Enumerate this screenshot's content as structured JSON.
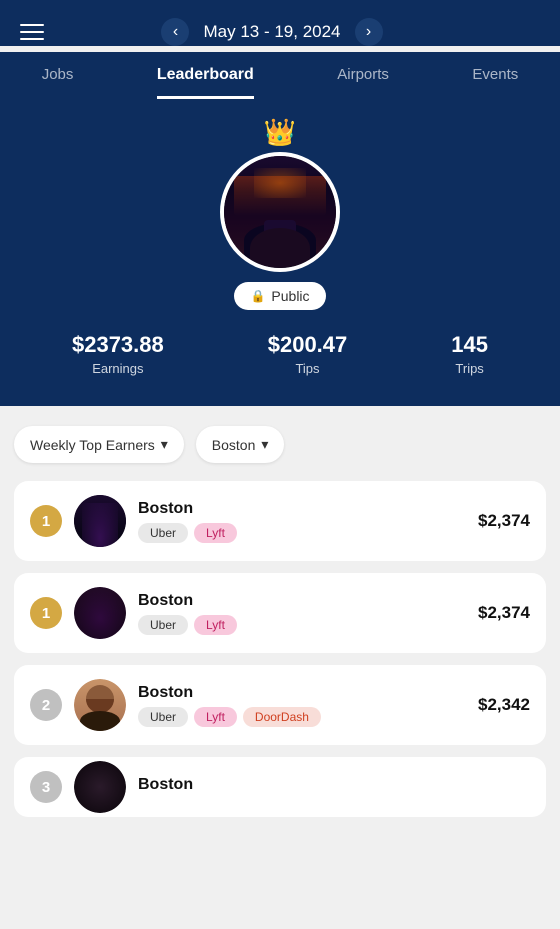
{
  "header": {
    "date_range": "May 13 - 19, 2024",
    "prev_label": "‹",
    "next_label": "›"
  },
  "tabs": [
    {
      "id": "jobs",
      "label": "Jobs",
      "active": false
    },
    {
      "id": "leaderboard",
      "label": "Leaderboard",
      "active": true
    },
    {
      "id": "airports",
      "label": "Airports",
      "active": false
    },
    {
      "id": "events",
      "label": "Events",
      "active": false
    }
  ],
  "hero": {
    "crown": "♛",
    "privacy": "Public",
    "lock": "🔒",
    "stats": [
      {
        "id": "earnings",
        "value": "$2373.88",
        "label": "Earnings"
      },
      {
        "id": "tips",
        "value": "$200.47",
        "label": "Tips"
      },
      {
        "id": "trips",
        "value": "145",
        "label": "Trips"
      }
    ]
  },
  "filters": {
    "earners_label": "Weekly Top Earners",
    "location_label": "Boston",
    "chevron": "▾"
  },
  "leaderboard": [
    {
      "rank": "1",
      "rank_type": "gold",
      "city": "Boston",
      "tags": [
        "Uber",
        "Lyft"
      ],
      "amount": "$2,374",
      "avatar_class": "av1"
    },
    {
      "rank": "1",
      "rank_type": "gold",
      "city": "Boston",
      "tags": [
        "Uber",
        "Lyft"
      ],
      "amount": "$2,374",
      "avatar_class": "av2"
    },
    {
      "rank": "2",
      "rank_type": "silver",
      "city": "Boston",
      "tags": [
        "Uber",
        "Lyft",
        "DoorDash"
      ],
      "amount": "$2,342",
      "avatar_class": "av3"
    },
    {
      "rank": "3",
      "rank_type": "silver",
      "city": "Boston",
      "tags": [],
      "amount": "",
      "avatar_class": "av4",
      "partial": true
    }
  ]
}
